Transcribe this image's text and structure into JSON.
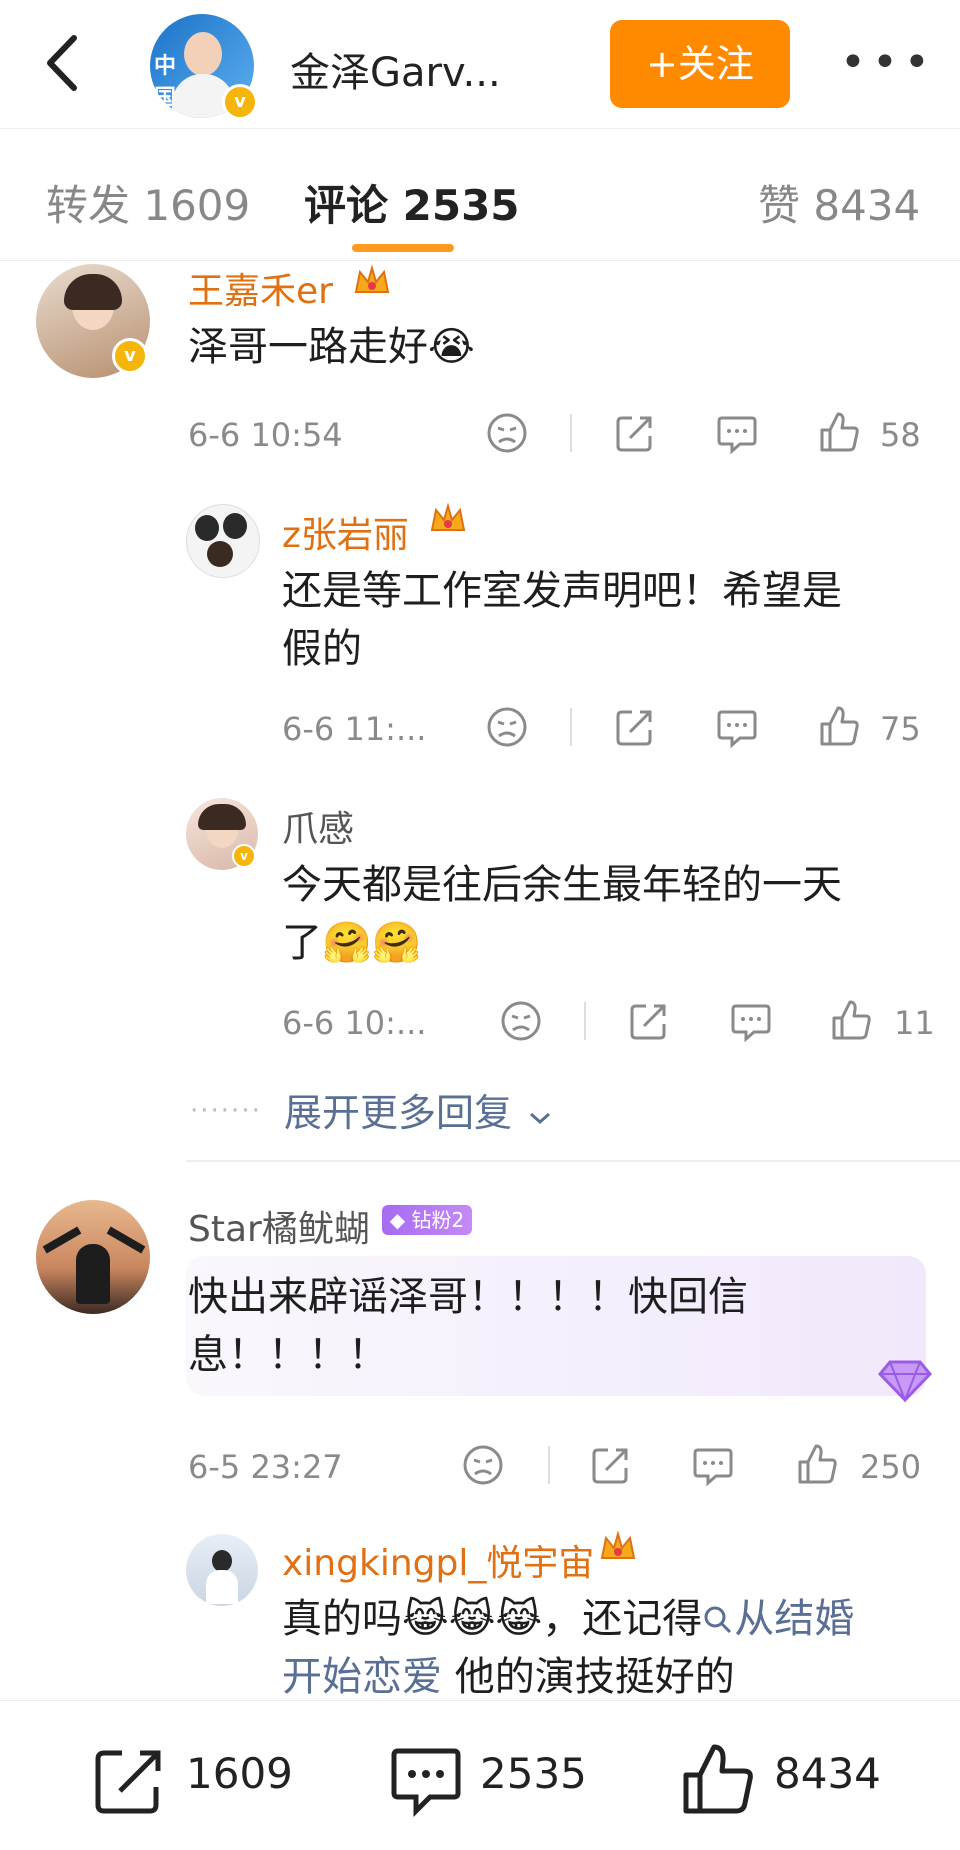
{
  "header": {
    "name": "金泽Garv...",
    "avatar_text": "中国 青年",
    "follow_label": "+关注"
  },
  "tabs": [
    {
      "label": "转发 1609"
    },
    {
      "label": "评论 2535"
    },
    {
      "label": "赞 8434"
    }
  ],
  "comments": [
    {
      "user": "王嘉禾er",
      "text": "泽哥一路走好",
      "emoji": "😭",
      "time": "6-6 10:54",
      "likes": "58"
    },
    {
      "user": "z张岩丽",
      "text_line1": "还是等工作室发声明吧！希望是",
      "text_line2": "假的",
      "time": "6-6 11:...",
      "likes": "75"
    },
    {
      "user": "爪感",
      "text_line1": "今天都是往后余生最年轻的一天",
      "text_line2": "了",
      "emoji": "🤗🤗",
      "time": "6-6 10:...",
      "likes": "11"
    },
    {
      "user": "Star橘鱿蝴",
      "badge": "钻粉2",
      "text_line1": "快出来辟谣泽哥！！！！快回信",
      "text_line2": "息！！！！",
      "time": "6-5 23:27",
      "likes": "250"
    },
    {
      "user": "xingkingpl_悦宇宙",
      "text_line1_a": "真的吗",
      "text_line1_emoji": "😹😹😹",
      "text_line1_b": "，还记得",
      "search_link_a": "从结婚",
      "text_line2_link": "开始恋爱",
      "text_line2_rest": " 他的演技挺好的"
    }
  ],
  "expand_label": "展开更多回复",
  "bottom": {
    "repost_count": "1609",
    "comment_count": "2535",
    "like_count": "8434"
  }
}
